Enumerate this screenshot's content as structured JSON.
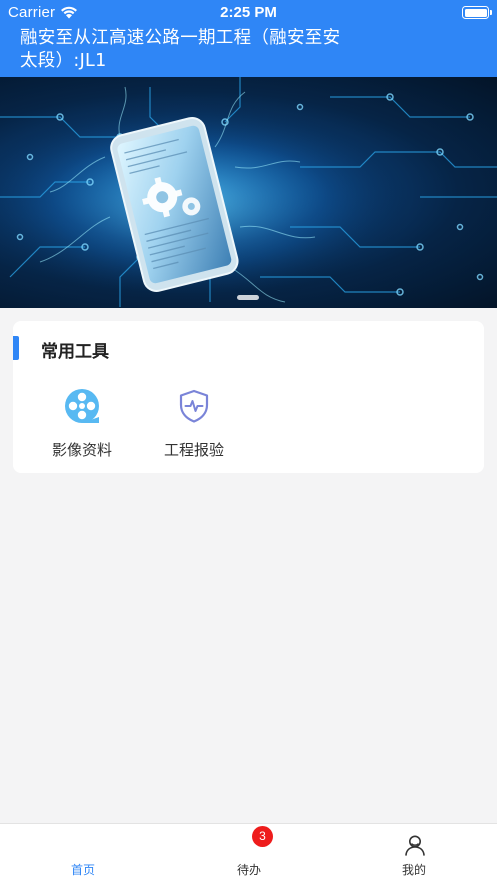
{
  "status_bar": {
    "carrier": "Carrier",
    "time": "2:25 PM",
    "wifi_icon": "wifi-icon",
    "battery_icon": "battery-icon"
  },
  "header": {
    "title": "融安至从江高速公路一期工程（融安至安太段）:JL1"
  },
  "banner": {
    "image": "circuit-smartphone-gears-illustration",
    "page_count": 1,
    "active_page": 1
  },
  "tools": {
    "section_title": "常用工具",
    "items": [
      {
        "label": "影像资料",
        "icon": "film-reel-icon",
        "color": "#58b9f2"
      },
      {
        "label": "工程报验",
        "icon": "shield-pulse-icon",
        "color": "#7a84d8"
      }
    ]
  },
  "tabbar": {
    "items": [
      {
        "label": "首页",
        "icon": "home-icon",
        "active": true
      },
      {
        "label": "待办",
        "icon": "todo-icon",
        "badge": "3"
      },
      {
        "label": "我的",
        "icon": "user-icon"
      }
    ],
    "active_color": "#2f86f6",
    "badge_color": "#ee1c1c"
  },
  "colors": {
    "primary": "#2f86f6",
    "background": "#f4f4f5"
  }
}
